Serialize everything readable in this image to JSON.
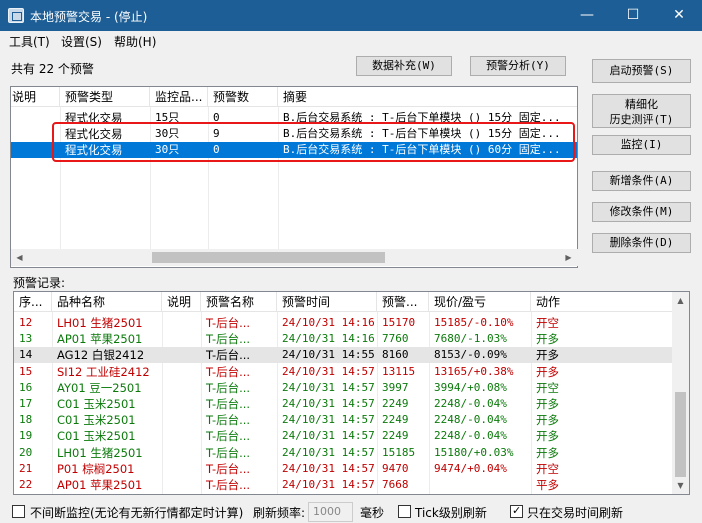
{
  "window": {
    "title": "本地预警交易 - (停止)",
    "minimize": "—",
    "maximize": "☐",
    "close": "✕"
  },
  "menu": [
    "工具(T)",
    "设置(S)",
    "帮助(H)"
  ],
  "count_text": "共有 22 个预警",
  "toolbar": {
    "data_fill": "数据补充(W)",
    "analysis": "预警分析(Y)"
  },
  "side_buttons": {
    "start": "启动预警(S)",
    "refine_line1": "精细化",
    "refine_line2": "历史测评(T)",
    "monitor": "监控(I)",
    "add": "新增条件(A)",
    "modify": "修改条件(M)",
    "delete": "删除条件(D)"
  },
  "alert_table": {
    "columns": [
      "说明",
      "预警类型",
      "监控品...",
      "预警数",
      "摘要"
    ],
    "rows": [
      {
        "note": "",
        "type": "程式化交易",
        "monitor": "15只",
        "count": "0",
        "summary": "B.后台交易系统 : T-后台下单模块 () 15分 固定..."
      },
      {
        "note": "",
        "type": "程式化交易",
        "monitor": "30只",
        "count": "9",
        "summary": "B.后台交易系统 : T-后台下单模块 () 15分 固定..."
      },
      {
        "note": "",
        "type": "程式化交易",
        "monitor": "30只",
        "count": "0",
        "summary": "B.后台交易系统 : T-后台下单模块 () 60分 固定..."
      }
    ]
  },
  "records_label": "预警记录:",
  "record_table": {
    "columns": [
      "序...",
      "品种名称",
      "说明",
      "预警名称",
      "预警时间",
      "预警...",
      "现价/盈亏",
      "动作"
    ],
    "rows": [
      {
        "seq": "12",
        "name": "LH01 生猪2501",
        "note": "",
        "alert": "T-后台...",
        "time": "24/10/31 14:16",
        "price": "15170",
        "pnl": "15185/-0.10%",
        "action": "开空",
        "color": "red"
      },
      {
        "seq": "13",
        "name": "AP01 苹果2501",
        "note": "",
        "alert": "T-后台...",
        "time": "24/10/31 14:16",
        "price": "7760",
        "pnl": "7680/-1.03%",
        "action": "开多",
        "color": "green"
      },
      {
        "seq": "14",
        "name": "AG12 白银2412",
        "note": "",
        "alert": "T-后台...",
        "time": "24/10/31 14:55",
        "price": "8160",
        "pnl": "8153/-0.09%",
        "action": "开多",
        "color": "black"
      },
      {
        "seq": "15",
        "name": "SI12 工业硅2412",
        "note": "",
        "alert": "T-后台...",
        "time": "24/10/31 14:57",
        "price": "13115",
        "pnl": "13165/+0.38%",
        "action": "开多",
        "color": "red"
      },
      {
        "seq": "16",
        "name": "AY01 豆一2501",
        "note": "",
        "alert": "T-后台...",
        "time": "24/10/31 14:57",
        "price": "3997",
        "pnl": "3994/+0.08%",
        "action": "开空",
        "color": "green"
      },
      {
        "seq": "17",
        "name": "C01 玉米2501",
        "note": "",
        "alert": "T-后台...",
        "time": "24/10/31 14:57",
        "price": "2249",
        "pnl": "2248/-0.04%",
        "action": "开多",
        "color": "green"
      },
      {
        "seq": "18",
        "name": "C01 玉米2501",
        "note": "",
        "alert": "T-后台...",
        "time": "24/10/31 14:57",
        "price": "2249",
        "pnl": "2248/-0.04%",
        "action": "开多",
        "color": "green"
      },
      {
        "seq": "19",
        "name": "C01 玉米2501",
        "note": "",
        "alert": "T-后台...",
        "time": "24/10/31 14:57",
        "price": "2249",
        "pnl": "2248/-0.04%",
        "action": "开多",
        "color": "green"
      },
      {
        "seq": "20",
        "name": "LH01 生猪2501",
        "note": "",
        "alert": "T-后台...",
        "time": "24/10/31 14:57",
        "price": "15185",
        "pnl": "15180/+0.03%",
        "action": "开多",
        "color": "green"
      },
      {
        "seq": "21",
        "name": "P01 棕榈2501",
        "note": "",
        "alert": "T-后台...",
        "time": "24/10/31 14:57",
        "price": "9470",
        "pnl": "9474/+0.04%",
        "action": "开空",
        "color": "red"
      },
      {
        "seq": "22",
        "name": "AP01 苹果2501",
        "note": "",
        "alert": "T-后台...",
        "time": "24/10/31 14:57",
        "price": "7668",
        "pnl": "",
        "action": "平多",
        "color": "red"
      }
    ]
  },
  "footer": {
    "continuous_label": "不间断监控(无论有无新行情都定时计算)",
    "continuous_checked": false,
    "refresh_label": "刷新频率:",
    "refresh_value": "1000",
    "ms_label": "毫秒",
    "tick_label": "Tick级别刷新",
    "tick_checked": false,
    "trading_only_label": "只在交易时间刷新",
    "trading_only_checked": true
  },
  "colors": {
    "title_bar": "#1c5e95",
    "selected_row": "#0078d7",
    "highlight": "#e81818",
    "red_text": "#c00000",
    "green_text": "#0b7a0b"
  }
}
